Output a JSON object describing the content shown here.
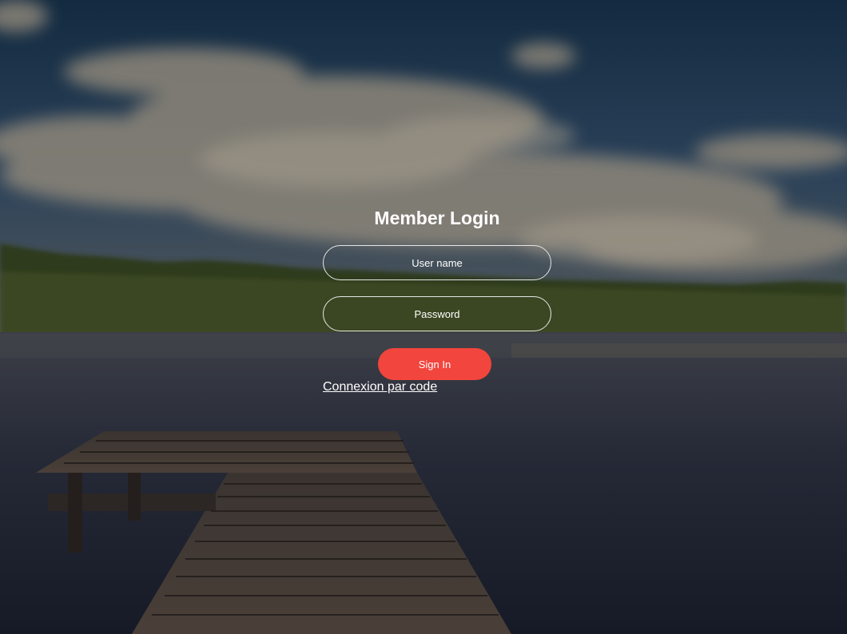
{
  "login": {
    "title": "Member Login",
    "username_placeholder": "User name",
    "password_placeholder": "Password",
    "signin_label": "Sign In",
    "code_link": "Connexion par code"
  },
  "colors": {
    "accent": "#f2453d",
    "text": "#ffffff",
    "field_border": "#e6e6e6"
  }
}
